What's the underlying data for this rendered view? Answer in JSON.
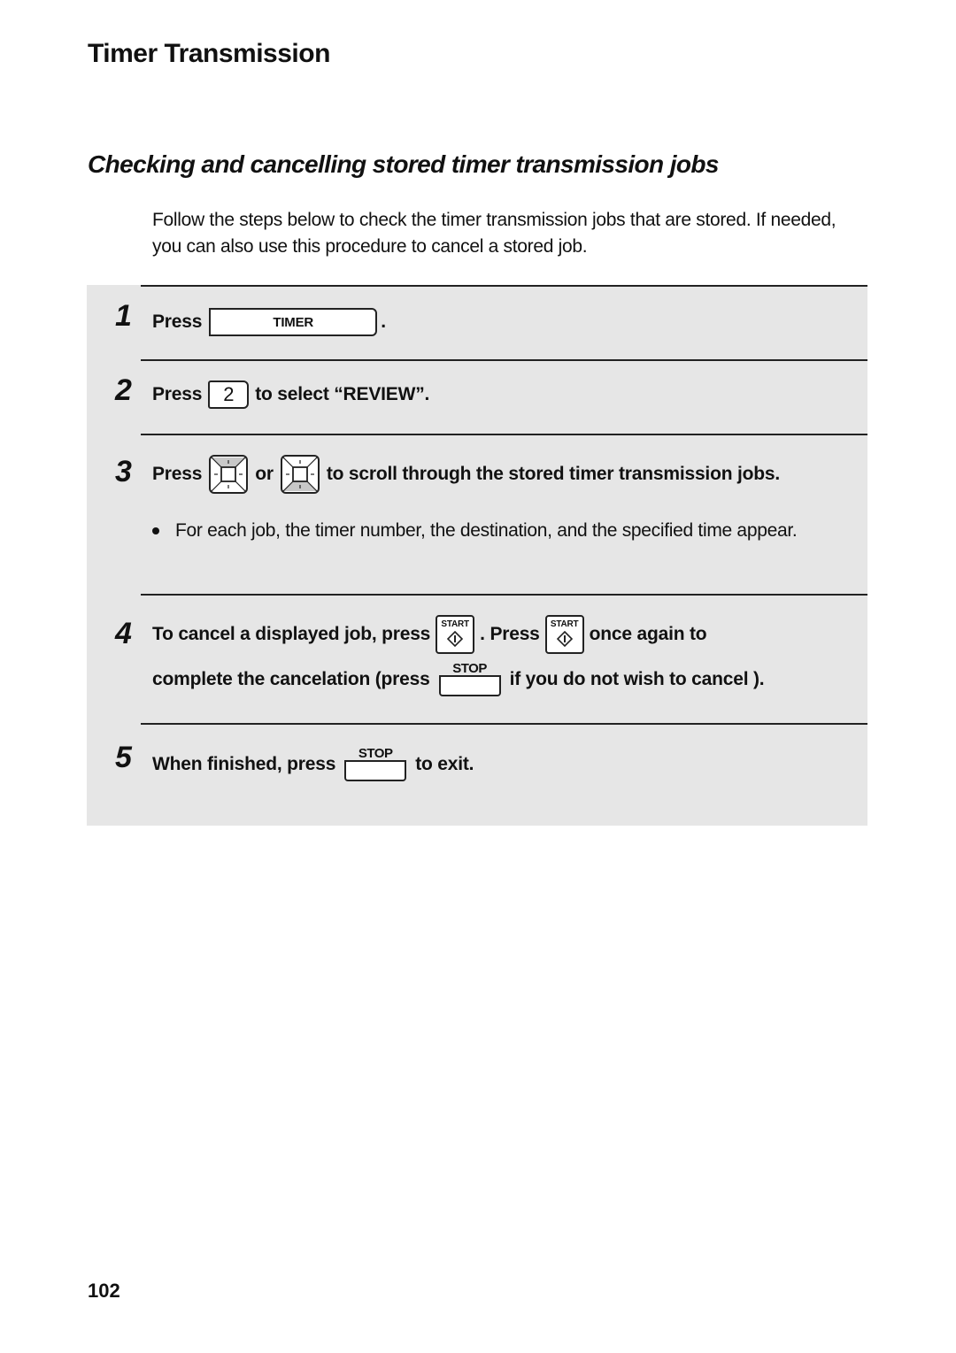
{
  "page": {
    "section_title": "Timer Transmission",
    "sub_title": "Checking and cancelling stored timer transmission jobs",
    "intro": "Follow the steps below to check the timer transmission jobs that are stored. If needed, you can also use this procedure to cancel a stored job.",
    "page_number": "102"
  },
  "keys": {
    "timer": "TIMER",
    "two": "2",
    "start": "START",
    "stop": "STOP",
    "up_arrow_icon": "up-arrow-key",
    "down_arrow_icon": "down-arrow-key"
  },
  "steps": [
    {
      "number": "1",
      "press": "Press",
      "after": "."
    },
    {
      "number": "2",
      "press": "Press",
      "after": "to select “REVIEW”."
    },
    {
      "number": "3",
      "press": "Press",
      "or": "or",
      "after": "to scroll through the stored timer transmission jobs.",
      "bullet": "For each job, the timer number, the destination, and the specified time appear."
    },
    {
      "number": "4",
      "line1_a": "To cancel a displayed job, press",
      "line1_b": ". Press",
      "line1_c": "once again to",
      "line2_a": "complete the cancelation (press",
      "line2_b": "if you do not wish to cancel )."
    },
    {
      "number": "5",
      "before": "When finished, press",
      "after": "to exit."
    }
  ],
  "colors": {
    "panel_bg": "#e6e6e6",
    "text": "#111111",
    "key_shade": "#c8c8c8"
  }
}
